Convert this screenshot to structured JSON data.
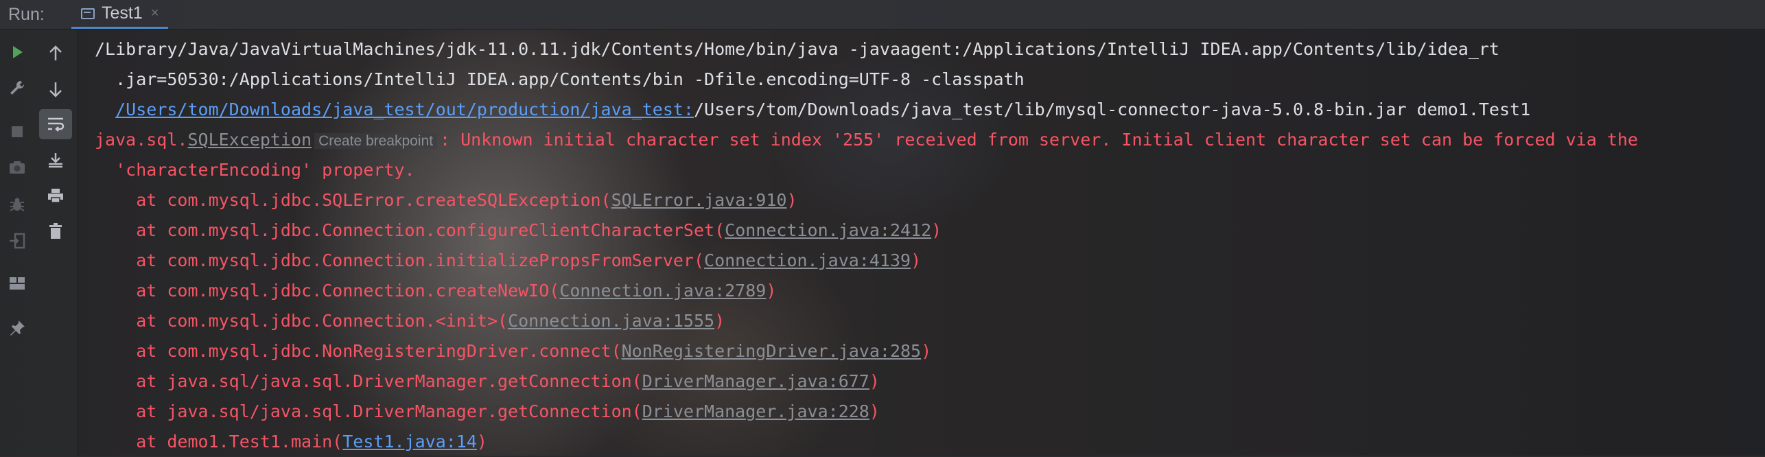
{
  "header": {
    "run_label": "Run:",
    "tab_label": "Test1",
    "tab_close": "×"
  },
  "left_toolbar": {
    "icons": [
      "run-icon",
      "wrench-icon",
      "stop-icon",
      "camera-icon",
      "debug-bug-icon",
      "login-icon",
      "layout-icon",
      "pin-icon"
    ]
  },
  "console_toolbar": {
    "icons": [
      "arrow-up-icon",
      "arrow-down-icon",
      "soft-wrap-icon",
      "scroll-to-end-icon",
      "print-icon",
      "trash-icon"
    ]
  },
  "console": {
    "l1": "/Library/Java/JavaVirtualMachines/jdk-11.0.11.jdk/Contents/Home/bin/java -javaagent:/Applications/IntelliJ IDEA.app/Contents/lib/idea_rt",
    "l2": "  .jar=50530:/Applications/IntelliJ IDEA.app/Contents/bin -Dfile.encoding=UTF-8 -classpath",
    "l3_link": "/Users/tom/Downloads/java_test/out/production/java_test:",
    "l3_rest": "/Users/tom/Downloads/java_test/lib/mysql-connector-java-5.0.8-bin.jar demo1.Test1",
    "l4_prefix": "java.sql.",
    "l4_exc": "SQLException",
    "l4_tip": "Create breakpoint",
    "l4_msg": ": Unknown initial character set index '255' received from server. Initial client character set can be forced via the",
    "l5": "  'characterEncoding' property.",
    "frames": [
      {
        "pre": "    at com.mysql.jdbc.SQLError.createSQLException(",
        "src": "SQLError.java:910",
        "post": ")"
      },
      {
        "pre": "    at com.mysql.jdbc.Connection.configureClientCharacterSet(",
        "src": "Connection.java:2412",
        "post": ")"
      },
      {
        "pre": "    at com.mysql.jdbc.Connection.initializePropsFromServer(",
        "src": "Connection.java:4139",
        "post": ")"
      },
      {
        "pre": "    at com.mysql.jdbc.Connection.createNewIO(",
        "src": "Connection.java:2789",
        "post": ")"
      },
      {
        "pre": "    at com.mysql.jdbc.Connection.<init>(",
        "src": "Connection.java:1555",
        "post": ")"
      },
      {
        "pre": "    at com.mysql.jdbc.NonRegisteringDriver.connect(",
        "src": "NonRegisteringDriver.java:285",
        "post": ")"
      },
      {
        "pre": "    at java.sql/java.sql.DriverManager.getConnection(",
        "src": "DriverManager.java:677",
        "post": ")"
      },
      {
        "pre": "    at java.sql/java.sql.DriverManager.getConnection(",
        "src": "DriverManager.java:228",
        "post": ")"
      },
      {
        "pre": "    at demo1.Test1.main(",
        "src": "Test1.java:14",
        "post": ")"
      }
    ]
  },
  "colors": {
    "error": "#f75464",
    "link": "#5b9ef7",
    "plain": "#dcdfe4",
    "run_green": "#4fa35a"
  }
}
